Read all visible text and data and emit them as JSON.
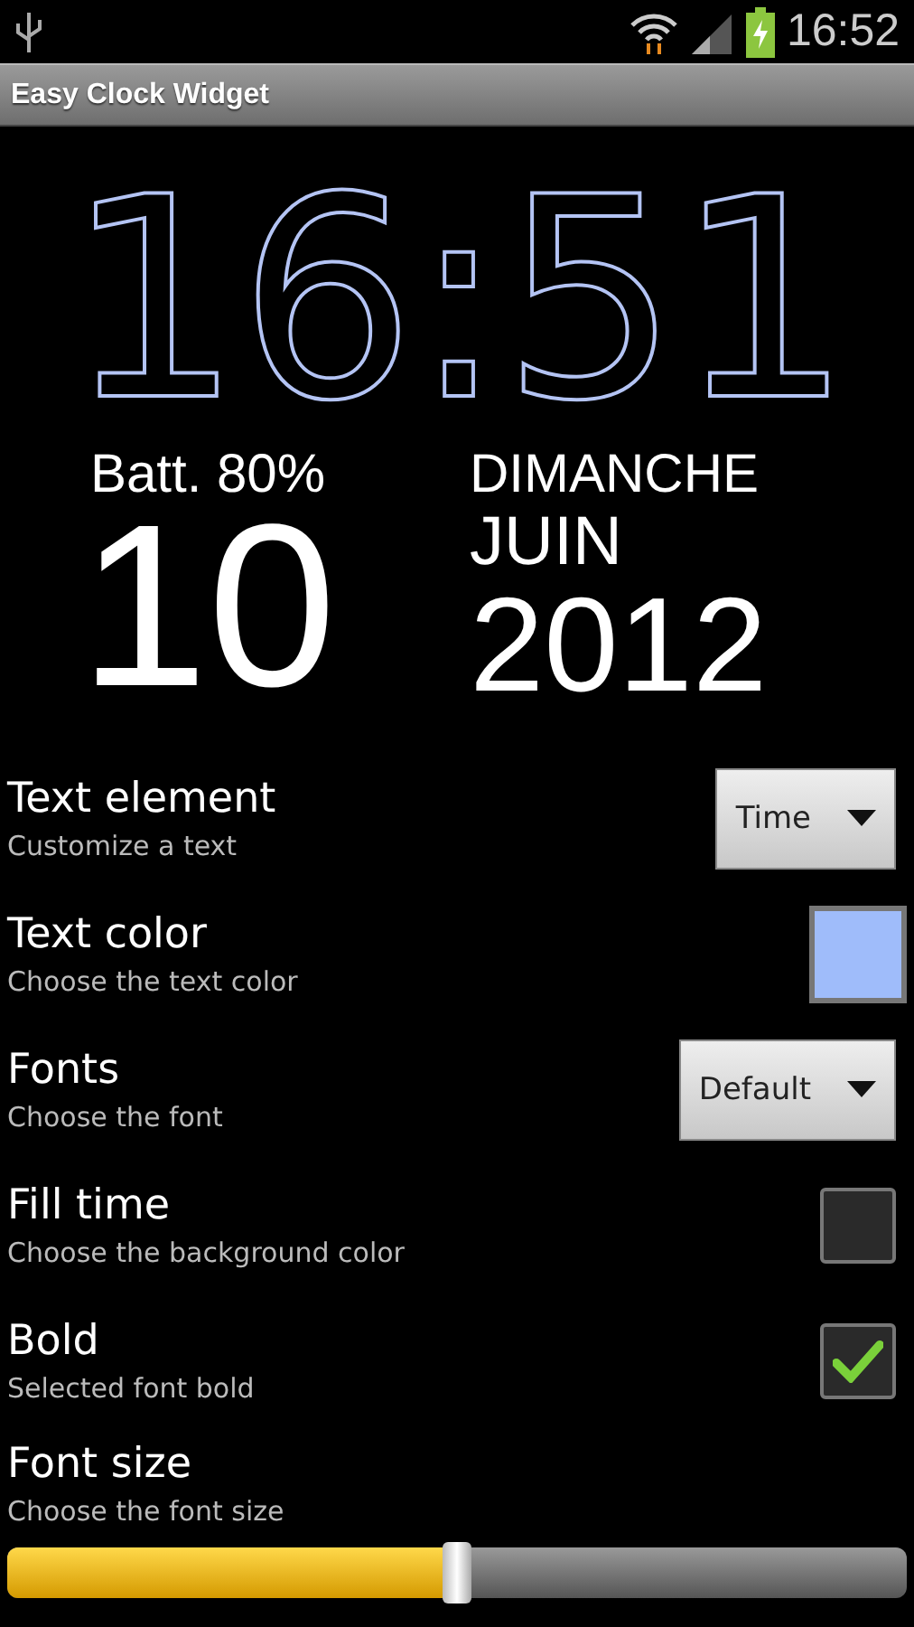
{
  "status_bar": {
    "time": "16:52",
    "battery_charging": true
  },
  "app_bar": {
    "title": "Easy Clock Widget"
  },
  "clock": {
    "time": "16:51",
    "battery": "Batt. 80%",
    "day": "10",
    "weekday": "DIMANCHE",
    "month": "JUIN",
    "year": "2012"
  },
  "settings": [
    {
      "kind": "dropdown",
      "title": "Text element",
      "summary": "Customize a text",
      "value": "Time"
    },
    {
      "kind": "color",
      "title": "Text color",
      "summary": "Choose the text color",
      "color": "#9fbcfa"
    },
    {
      "kind": "dropdown",
      "title": "Fonts",
      "summary": "Choose the font",
      "value": "Default"
    },
    {
      "kind": "checkbox",
      "title": "Fill time",
      "summary": "Choose the background color",
      "checked": false
    },
    {
      "kind": "checkbox",
      "title": "Bold",
      "summary": "Selected font bold",
      "checked": true
    },
    {
      "kind": "slider",
      "title": "Font size",
      "summary": "Choose the font size",
      "level": 0.5
    }
  ]
}
